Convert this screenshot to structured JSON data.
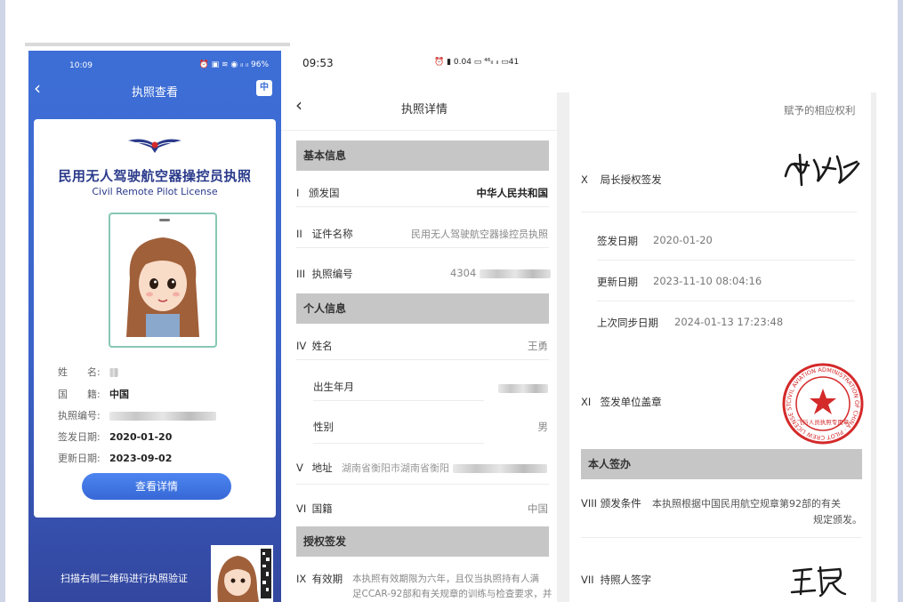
{
  "panel1": {
    "status_time": "10:09",
    "status_icons": "⏰ ▣ ≋ ◉ ᵢₗ ᵢₗ 96%",
    "title": "执照查看",
    "lang_button": "中",
    "license_title_cn": "民用无人驾驶航空器操控员执照",
    "license_title_en": "Civil Remote Pilot License",
    "info": [
      {
        "label": "姓　　名:",
        "value": ""
      },
      {
        "label": "国　　籍:",
        "value": "中国"
      },
      {
        "label": "执照编号:",
        "value": ""
      },
      {
        "label": "签发日期:",
        "value": "2020-01-20"
      },
      {
        "label": "更新日期:",
        "value": "2023-09-02"
      }
    ],
    "view_details_button": "查看详情",
    "scan_hint": "扫描右侧二维码进行执照验证"
  },
  "panel2": {
    "status_time": "09:53",
    "status_icons": "⏰ ▮ 0.04 ▭ ⁴⁶ᵢₗ ᵢₗ ▭41",
    "title": "执照详情",
    "sections": {
      "basic": "基本信息",
      "personal": "个人信息",
      "authorization": "授权签发"
    },
    "rows": {
      "issuing_country": {
        "num": "I",
        "label": "颁发国",
        "value": "中华人民共和国"
      },
      "certificate_name": {
        "num": "II",
        "label": "证件名称",
        "value": "民用无人驾驶航空器操控员执照"
      },
      "license_number": {
        "num": "III",
        "label": "执照编号",
        "value": "4304"
      },
      "name": {
        "num": "IV",
        "label": "姓名",
        "value": "王勇"
      },
      "birth_date": {
        "label": "出生年月",
        "value": ""
      },
      "gender": {
        "label": "性别",
        "value": "男"
      },
      "address": {
        "num": "V",
        "label": "地址",
        "value": "湖南省衡阳市湖南省衡阳"
      },
      "nationality": {
        "num": "VI",
        "label": "国籍",
        "value": "中国"
      },
      "validity": {
        "num": "IX",
        "label": "有效期",
        "value_line1": "本执照有效期限为六年，且仅当执照持有人满",
        "value_line2": "足CCAR-92部和有关规章的训练与检查要求，并"
      }
    }
  },
  "panel3": {
    "rights_text": "赋予的相应权利",
    "director_sign": {
      "num": "X",
      "label": "局长授权签发",
      "signature": "韩光祖"
    },
    "issue_date": {
      "label": "签发日期",
      "value": "2020-01-20"
    },
    "update_date": {
      "label": "更新日期",
      "value": "2023-11-10 08:04:16"
    },
    "last_sync": {
      "label": "上次同步日期",
      "value": "2024-01-13 17:23:48"
    },
    "seal": {
      "num": "XI",
      "label": "签发单位盖章",
      "seal_ring_text": "CIVIL AVIATION ADMINISTRATION OF CHINA · PILOT CREW LICENSE STAMP",
      "seal_center_text": "飞行人员执照专用章"
    },
    "holder_section": "本人签办",
    "conditions": {
      "num": "VIII",
      "label": "颁发条件",
      "value_line1": "本执照根据中国民用航空规章第92部的有关",
      "value_line2": "规定颁发。"
    },
    "holder_signature": {
      "num": "VII",
      "label": "持照人签字",
      "signature": "王勇"
    }
  },
  "colors": {
    "panel1_blue": "#3d6fd7",
    "title_navy": "#2a3a8a",
    "section_gray": "#c6c6c6",
    "seal_red": "#d42a2a"
  }
}
